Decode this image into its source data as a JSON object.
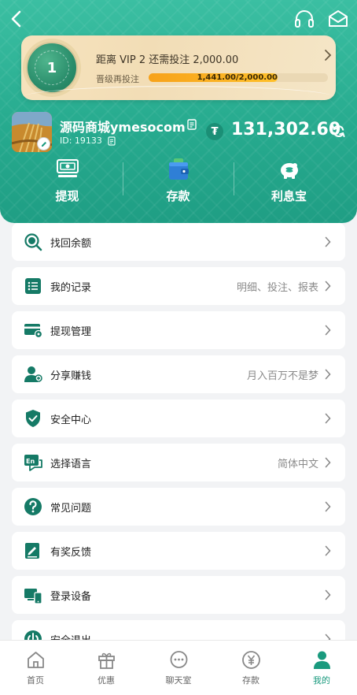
{
  "vip": {
    "badge_level": "1",
    "title": "距离 VIP 2 还需投注 2,000.00",
    "progress_label": "晋级再投注",
    "progress_text": "1,441.00/2,000.00",
    "progress_fraction": 0.7205
  },
  "user": {
    "name": "源码商城ymesocom",
    "id_text": "ID: 19133",
    "balance": "131,302.60",
    "currency_symbol": "₮"
  },
  "actions": [
    {
      "label": "提现",
      "icon": "withdraw-icon"
    },
    {
      "label": "存款",
      "icon": "wallet-icon"
    },
    {
      "label": "利息宝",
      "icon": "piggy-bank-icon"
    }
  ],
  "menu": [
    {
      "label": "找回余额",
      "value": "",
      "icon": "search-coin-icon"
    },
    {
      "label": "我的记录",
      "value": "明细、投注、报表",
      "icon": "list-icon"
    },
    {
      "label": "提现管理",
      "value": "",
      "icon": "card-settings-icon"
    },
    {
      "label": "分享赚钱",
      "value": "月入百万不是梦",
      "icon": "share-user-icon"
    },
    {
      "label": "安全中心",
      "value": "",
      "icon": "shield-check-icon"
    },
    {
      "label": "选择语言",
      "value": "简体中文",
      "icon": "language-icon"
    },
    {
      "label": "常见问题",
      "value": "",
      "icon": "question-icon"
    },
    {
      "label": "有奖反馈",
      "value": "",
      "icon": "feedback-icon"
    },
    {
      "label": "登录设备",
      "value": "",
      "icon": "devices-icon"
    },
    {
      "label": "安全退出",
      "value": "",
      "icon": "power-icon"
    }
  ],
  "tabs": [
    {
      "label": "首页",
      "icon": "home-icon"
    },
    {
      "label": "优惠",
      "icon": "gift-icon"
    },
    {
      "label": "聊天室",
      "icon": "chat-icon"
    },
    {
      "label": "存款",
      "icon": "yen-icon"
    },
    {
      "label": "我的",
      "icon": "user-icon"
    }
  ],
  "colors": {
    "brand": "#27ab8f",
    "icon": "#157a66",
    "progress": "#f7a21a",
    "active_tab": "#1a9a7e"
  }
}
